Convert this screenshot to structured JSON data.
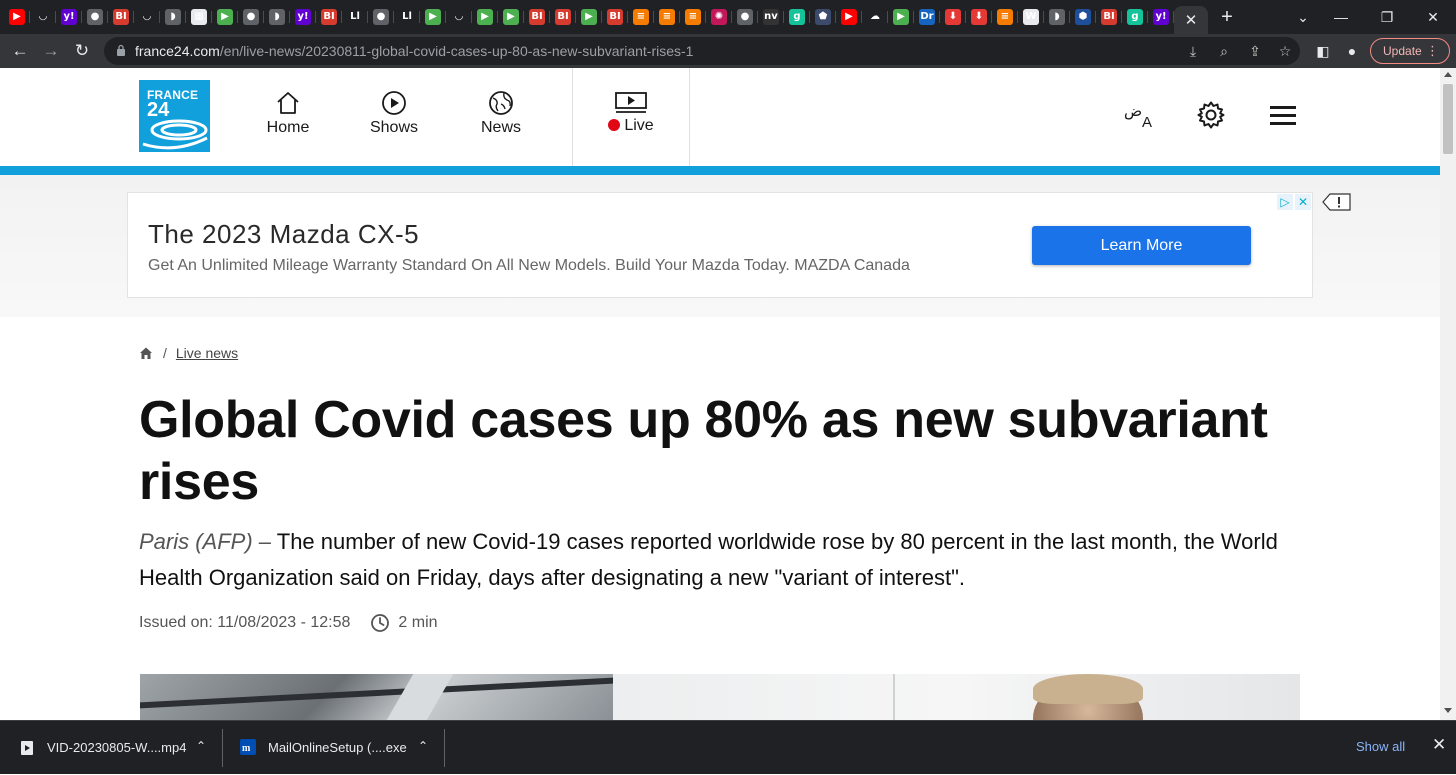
{
  "browser": {
    "tab_favicons": [
      {
        "icon": "youtube-icon",
        "glyph": "▶",
        "color": "#ff0000"
      },
      {
        "icon": "shield-icon",
        "glyph": "◡",
        "color": "#202124"
      },
      {
        "icon": "yahoo-icon",
        "glyph": "y!",
        "color": "#6001d2"
      },
      {
        "icon": "globe-icon",
        "glyph": "●",
        "color": "#5f6368"
      },
      {
        "icon": "business-insider-icon",
        "glyph": "BI",
        "color": "#d63b2f"
      },
      {
        "icon": "shield-icon",
        "glyph": "◡",
        "color": "#202124"
      },
      {
        "icon": "video-icon",
        "glyph": "◗",
        "color": "#5f6368"
      },
      {
        "icon": "document-icon",
        "glyph": "▦",
        "color": "#e8eaed"
      },
      {
        "icon": "play-icon",
        "glyph": "▶",
        "color": "#4caf50"
      },
      {
        "icon": "globe-icon",
        "glyph": "●",
        "color": "#5f6368"
      },
      {
        "icon": "video-icon",
        "glyph": "◗",
        "color": "#5f6368"
      },
      {
        "icon": "yahoo-icon",
        "glyph": "y!",
        "color": "#6001d2"
      },
      {
        "icon": "business-insider-icon",
        "glyph": "BI",
        "color": "#d63b2f"
      },
      {
        "icon": "italic-icon",
        "glyph": "Ll",
        "color": "#202124"
      },
      {
        "icon": "globe-icon",
        "glyph": "●",
        "color": "#5f6368"
      },
      {
        "icon": "italic-icon",
        "glyph": "Ll",
        "color": "#202124"
      },
      {
        "icon": "play-icon",
        "glyph": "▶",
        "color": "#4caf50"
      },
      {
        "icon": "shield-icon",
        "glyph": "◡",
        "color": "#202124"
      },
      {
        "icon": "play-icon",
        "glyph": "▶",
        "color": "#4caf50"
      },
      {
        "icon": "play-icon",
        "glyph": "▶",
        "color": "#4caf50"
      },
      {
        "icon": "business-insider-icon",
        "glyph": "BI",
        "color": "#d63b2f"
      },
      {
        "icon": "business-insider-icon",
        "glyph": "BI",
        "color": "#d63b2f"
      },
      {
        "icon": "play-icon",
        "glyph": "▶",
        "color": "#4caf50"
      },
      {
        "icon": "business-insider-icon",
        "glyph": "BI",
        "color": "#d63b2f"
      },
      {
        "icon": "bookmark-icon",
        "glyph": "≡",
        "color": "#f57c00"
      },
      {
        "icon": "bookmark-icon",
        "glyph": "≡",
        "color": "#f57c00"
      },
      {
        "icon": "bookmark-icon",
        "glyph": "≡",
        "color": "#f57c00"
      },
      {
        "icon": "burst-icon",
        "glyph": "✺",
        "color": "#c2185b"
      },
      {
        "icon": "globe-icon",
        "glyph": "●",
        "color": "#5f6368"
      },
      {
        "icon": "news-icon",
        "glyph": "nv",
        "color": "#333333"
      },
      {
        "icon": "grammarly-icon",
        "glyph": "g",
        "color": "#15c39a"
      },
      {
        "icon": "shield-icon",
        "glyph": "⬟",
        "color": "#3c4a6b"
      },
      {
        "icon": "youtube-icon",
        "glyph": "▶",
        "color": "#ff0000"
      },
      {
        "icon": "cloud-icon",
        "glyph": "☁",
        "color": "#202124"
      },
      {
        "icon": "play-icon",
        "glyph": "▶",
        "color": "#4caf50"
      },
      {
        "icon": "dr-icon",
        "glyph": "Dr",
        "color": "#1565c0"
      },
      {
        "icon": "microphone-icon",
        "glyph": "⬇",
        "color": "#e53935"
      },
      {
        "icon": "microphone-icon",
        "glyph": "⬇",
        "color": "#e53935"
      },
      {
        "icon": "bookmark-icon",
        "glyph": "≡",
        "color": "#f57c00"
      },
      {
        "icon": "wapo-icon",
        "glyph": "W",
        "color": "#e8eaed"
      },
      {
        "icon": "video-icon",
        "glyph": "◗",
        "color": "#5f6368"
      },
      {
        "icon": "hexagon-icon",
        "glyph": "⬢",
        "color": "#1e4f9c"
      },
      {
        "icon": "business-insider-icon",
        "glyph": "BI",
        "color": "#d63b2f"
      },
      {
        "icon": "grammarly-icon",
        "glyph": "g",
        "color": "#15c39a"
      },
      {
        "icon": "yahoo-icon",
        "glyph": "y!",
        "color": "#6001d2"
      }
    ],
    "active_tab_close": "✕",
    "new_tab": "+",
    "url_host": "france24.com",
    "url_path": "/en/live-news/20230811-global-covid-cases-up-80-as-new-subvariant-rises-1",
    "update_label": "Update"
  },
  "site": {
    "logo_line1": "FRANCE",
    "logo_line2": "24",
    "nav": {
      "home": "Home",
      "shows": "Shows",
      "news": "News",
      "live": "Live"
    },
    "live_dot_color": "#e20714",
    "brand_color": "#11a0dc"
  },
  "ad": {
    "title": "The 2023 Mazda CX-5",
    "subtitle": "Get An Unlimited Mileage Warranty Standard On All New Models. Build Your Mazda Today. MAZDA Canada",
    "cta": "Learn More"
  },
  "article": {
    "breadcrumb_sep": "/",
    "breadcrumb_link": "Live news",
    "headline": "Global Covid cases up 80% as new subvariant rises",
    "source": "Paris (AFP) –",
    "lede": "The number of new Covid-19 cases reported worldwide rose by 80 percent in the last month, the World Health Organization said on Friday, days after designating a new \"variant of interest\".",
    "issued": "Issued on: 11/08/2023 - 12:58",
    "read_time": "2 min"
  },
  "downloads": {
    "items": [
      {
        "name": "VID-20230805-W....mp4"
      },
      {
        "name": "MailOnlineSetup (....exe"
      }
    ],
    "show_all": "Show all"
  }
}
